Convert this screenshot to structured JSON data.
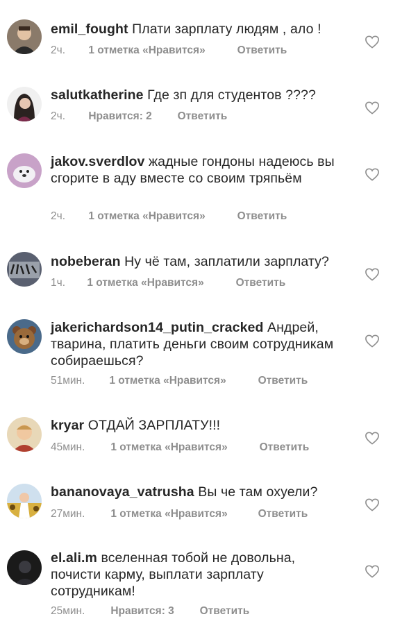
{
  "comments": [
    {
      "username": "emil_fought",
      "text": "Плати зарплату людям , ало !",
      "time": "2ч.",
      "likes": "1 отметка «Нравится»",
      "reply": "Ответить",
      "avatar_color": "#8a7a6a",
      "avatar_icon": "person-avatar-icon"
    },
    {
      "username": "salutkatherine",
      "text": "Где зп для студентов ????",
      "time": "2ч.",
      "likes": "Нравится: 2",
      "reply": "Ответить",
      "avatar_color": "#2a2220",
      "avatar_icon": "person-avatar-icon"
    },
    {
      "username": "jakov.sverdlov",
      "text": "жадные гондоны надеюсь вы сгорите в аду вместе со своим тряпьём",
      "time": "2ч.",
      "likes": "1 отметка «Нравится»",
      "reply": "Ответить",
      "avatar_color": "#c8a2c8",
      "avatar_icon": "dog-avatar-icon"
    },
    {
      "username": "nobeberan",
      "text": "Ну чё там, заплатили зарплату?",
      "time": "1ч.",
      "likes": "1 отметка «Нравится»",
      "reply": "Ответить",
      "avatar_color": "#5a6070",
      "avatar_icon": "graffiti-avatar-icon"
    },
    {
      "username": "jakerichardson14_putin_cracked",
      "text": "Андрей, тварина, платить деньги своим сотрудникам собираешься?",
      "time": "51мин.",
      "likes": "1 отметка «Нравится»",
      "reply": "Ответить",
      "avatar_color": "#7a4a2a",
      "avatar_icon": "bear-avatar-icon"
    },
    {
      "username": "kryar",
      "text": "ОТДАЙ ЗАРПЛАТУ!!!",
      "time": "45мин.",
      "likes": "1 отметка «Нравится»",
      "reply": "Ответить",
      "avatar_color": "#d9b58a",
      "avatar_icon": "child-avatar-icon"
    },
    {
      "username": "bananovaya_vatrusha",
      "text": "Вы че там охуели?",
      "time": "27мин.",
      "likes": "1 отметка «Нравится»",
      "reply": "Ответить",
      "avatar_color": "#d8b040",
      "avatar_icon": "sunflower-avatar-icon"
    },
    {
      "username": "el.ali.m",
      "text": "вселенная тобой не довольна, почисти карму, выплати зарплату сотрудникам!",
      "time": "25мин.",
      "likes": "Нравится: 3",
      "reply": "Ответить",
      "avatar_color": "#1a1a1a",
      "avatar_icon": "dark-avatar-icon"
    }
  ]
}
